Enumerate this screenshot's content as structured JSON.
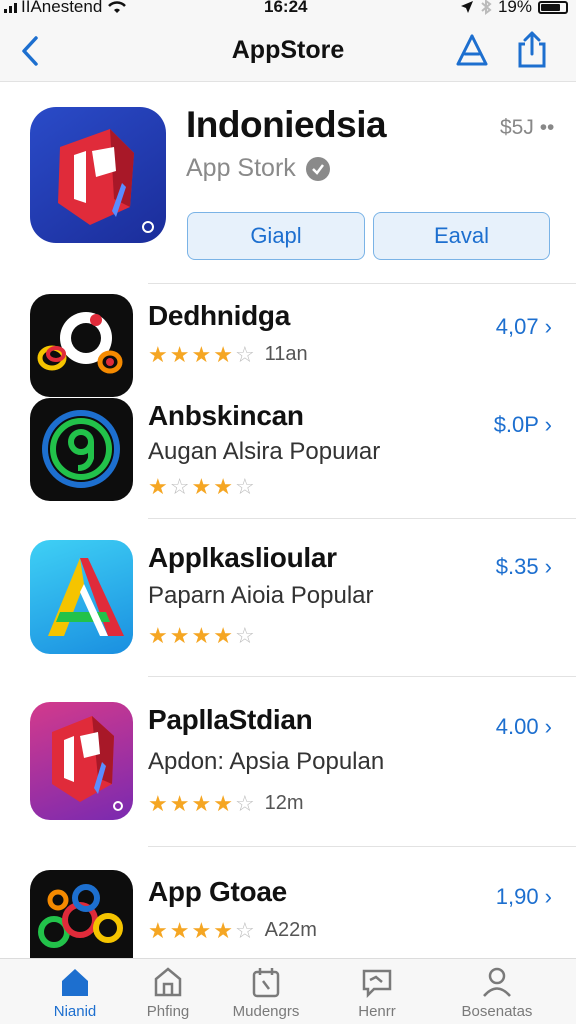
{
  "status_bar": {
    "carrier": "IIAnestend",
    "time": "16:24",
    "battery": "19%"
  },
  "nav": {
    "title": "AppStore"
  },
  "featured": {
    "name": "Indoniedsia",
    "subtitle": "App Stork",
    "price": "$5J ••",
    "button1": "Giapl",
    "button2": "Eaval"
  },
  "apps": [
    {
      "name": "Dedhnidga",
      "desc": "",
      "price": "4,07 ›",
      "rating": 4,
      "count": "11an"
    },
    {
      "name": "Anbskincan",
      "desc": "Augan Alsira Popuиar",
      "price": "$.0P ›",
      "rating": 3,
      "count": ""
    },
    {
      "name": "Applkaslioular",
      "desc": "Paparn Aioia Popular",
      "price": "$.35 ›",
      "rating": 3.5,
      "count": ""
    },
    {
      "name": "PapllaStdian",
      "desc": "Aрdon: Apsia Populan",
      "price": "4.00 ›",
      "rating": 3.5,
      "count": "12m"
    },
    {
      "name": "App Gtoae",
      "desc": "",
      "price": "1,90 ›",
      "rating": 4,
      "count": "A22m"
    }
  ],
  "tabs": [
    {
      "label": "Nianid",
      "icon": "home-icon"
    },
    {
      "label": "Phfing",
      "icon": "store-icon"
    },
    {
      "label": "Mudengrs",
      "icon": "calendar-icon"
    },
    {
      "label": "Henrr",
      "icon": "chat-icon"
    },
    {
      "label": "Bosenatas",
      "icon": "person-icon"
    }
  ],
  "colors": {
    "accent": "#1d6fcf",
    "star": "#f5a623"
  }
}
